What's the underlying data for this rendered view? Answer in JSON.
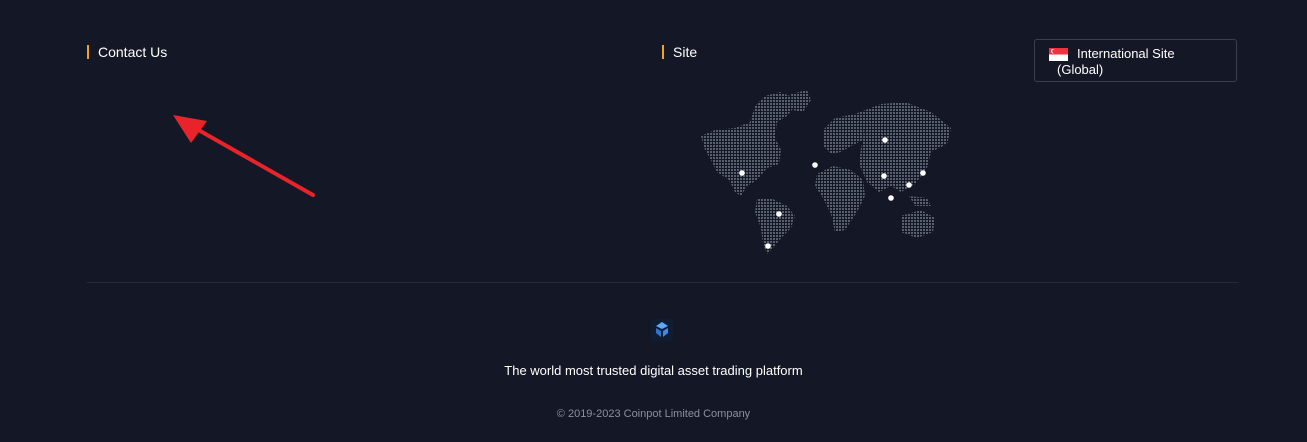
{
  "contact": {
    "title": "Contact Us"
  },
  "site": {
    "title": "Site",
    "selector": {
      "label_line1": "International Site",
      "label_line2": "(Global)",
      "flag_icon": "singapore-flag-icon"
    }
  },
  "footer": {
    "logo_icon": "coinpot-logo-icon",
    "tagline": "The world most trusted digital asset trading platform",
    "copyright": "© 2019-2023 Coinpot Limited Company"
  },
  "colors": {
    "background": "#141826",
    "accent": "#f0a41f",
    "arrow": "#e8232a",
    "divider": "#242a3a",
    "muted_text": "#8a8f9e"
  }
}
